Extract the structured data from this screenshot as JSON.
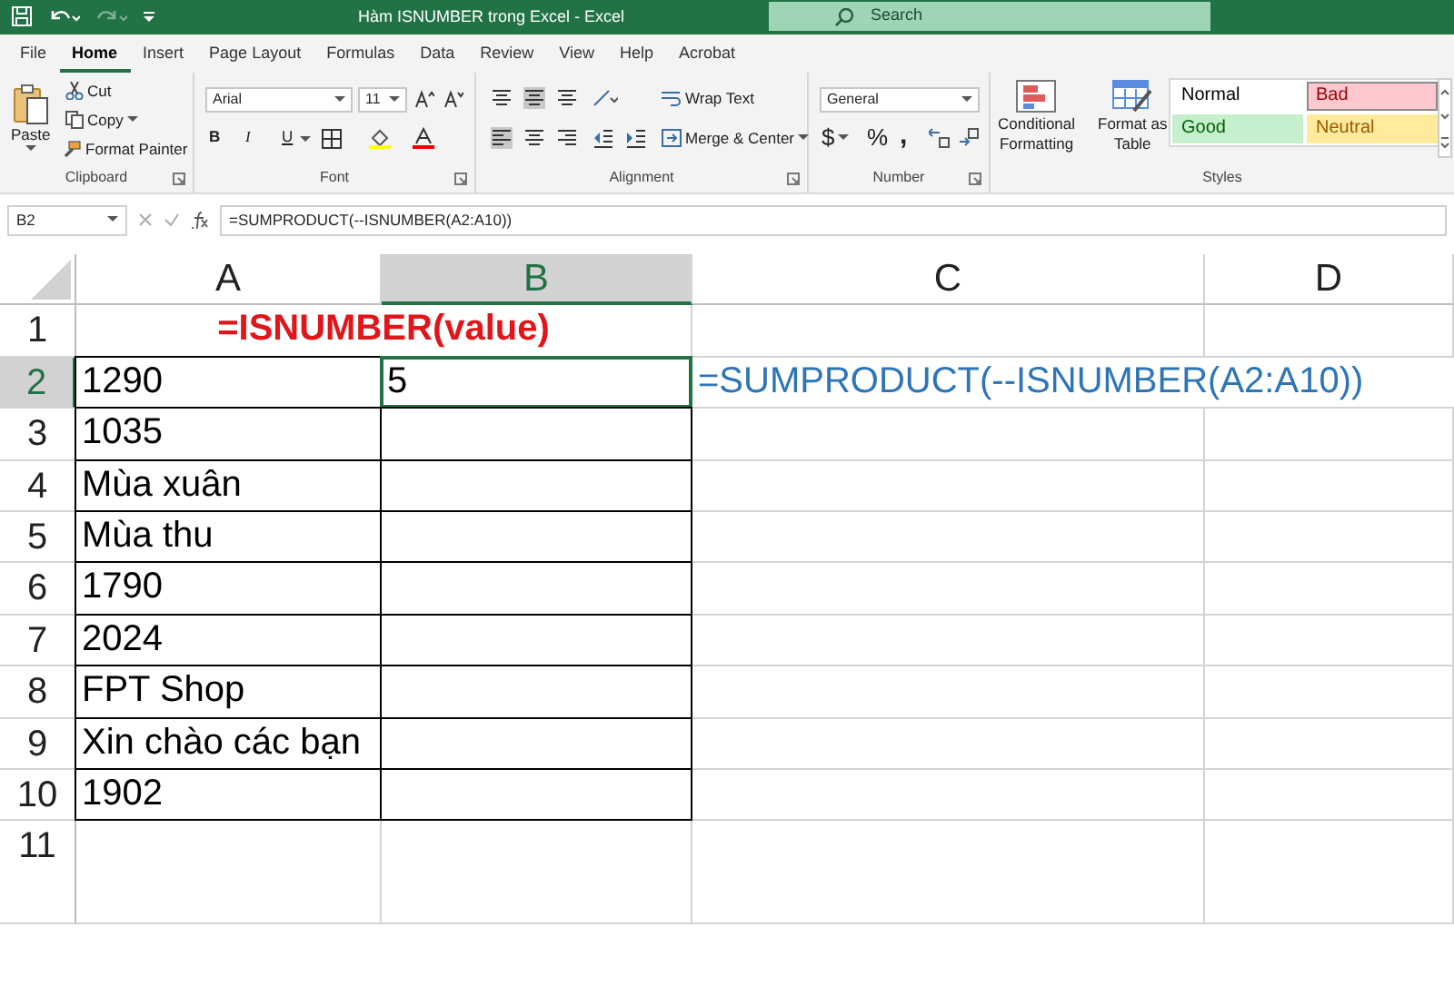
{
  "title_bar": {
    "title": "Hàm ISNUMBER trong Excel  -  Excel",
    "search_placeholder": "Search"
  },
  "menu_tabs": [
    {
      "label": "File",
      "selected": false
    },
    {
      "label": "Home",
      "selected": true
    },
    {
      "label": "Insert",
      "selected": false
    },
    {
      "label": "Page Layout",
      "selected": false
    },
    {
      "label": "Formulas",
      "selected": false
    },
    {
      "label": "Data",
      "selected": false
    },
    {
      "label": "Review",
      "selected": false
    },
    {
      "label": "View",
      "selected": false
    },
    {
      "label": "Help",
      "selected": false
    },
    {
      "label": "Acrobat",
      "selected": false
    }
  ],
  "ribbon": {
    "clipboard": {
      "paste": "Paste",
      "cut": "Cut",
      "copy": "Copy",
      "format_painter": "Format Painter",
      "label": "Clipboard"
    },
    "font": {
      "font_name": "Arial",
      "font_size": "11",
      "bold": "B",
      "italic": "I",
      "underline": "U",
      "label": "Font"
    },
    "alignment": {
      "wrap_text": "Wrap Text",
      "merge_center": "Merge & Center",
      "label": "Alignment"
    },
    "number": {
      "format": "General",
      "currency": "$",
      "percent": "%",
      "comma": ",",
      "label": "Number"
    },
    "styles": {
      "conditional_formatting": [
        "Conditional",
        "Formatting"
      ],
      "format_as_table": [
        "Format as",
        "Table"
      ],
      "gallery": [
        {
          "label": "Normal",
          "kind": "normal",
          "selected": false
        },
        {
          "label": "Bad",
          "kind": "bad",
          "selected": true
        },
        {
          "label": "Good",
          "kind": "good",
          "selected": false
        },
        {
          "label": "Neutral",
          "kind": "neutral",
          "selected": false
        }
      ],
      "label": "Styles"
    }
  },
  "formula_bar": {
    "name_box": "B2",
    "formula": "=SUMPRODUCT(--ISNUMBER(A2:A10))"
  },
  "sheet": {
    "columns": [
      {
        "label": "A",
        "selected": false
      },
      {
        "label": "B",
        "selected": true
      },
      {
        "label": "C",
        "selected": false
      },
      {
        "label": "D",
        "selected": false
      }
    ],
    "rows": [
      {
        "label": "1",
        "selected": false,
        "cells": {
          "ab": {
            "text": "=ISNUMBER(value)",
            "kind": "title",
            "selected": false
          }
        }
      },
      {
        "label": "2",
        "selected": true,
        "cells": {
          "a": {
            "text": "1290",
            "kind": "value",
            "selected": false
          },
          "b": {
            "text": "5",
            "kind": "value",
            "selected": true
          },
          "c": {
            "text": "=SUMPRODUCT(--ISNUMBER(A2:A10))",
            "kind": "formula",
            "selected": false
          }
        }
      },
      {
        "label": "3",
        "selected": false,
        "cells": {
          "a": {
            "text": "1035",
            "kind": "value",
            "selected": false
          },
          "b": {
            "kind": "value",
            "selected": false
          }
        }
      },
      {
        "label": "4",
        "selected": false,
        "cells": {
          "a": {
            "text": "Mùa xuân",
            "kind": "value",
            "selected": false
          },
          "b": {
            "kind": "value",
            "selected": false
          }
        }
      },
      {
        "label": "5",
        "selected": false,
        "cells": {
          "a": {
            "text": "Mùa thu",
            "kind": "value",
            "selected": false
          },
          "b": {
            "kind": "value",
            "selected": false
          }
        }
      },
      {
        "label": "6",
        "selected": false,
        "cells": {
          "a": {
            "text": "1790",
            "kind": "value",
            "selected": false
          },
          "b": {
            "kind": "value",
            "selected": false
          }
        }
      },
      {
        "label": "7",
        "selected": false,
        "cells": {
          "a": {
            "text": "2024",
            "kind": "value",
            "selected": false
          },
          "b": {
            "kind": "value",
            "selected": false
          }
        }
      },
      {
        "label": "8",
        "selected": false,
        "cells": {
          "a": {
            "text": "FPT Shop",
            "kind": "value",
            "selected": false
          },
          "b": {
            "kind": "value",
            "selected": false
          }
        }
      },
      {
        "label": "9",
        "selected": false,
        "cells": {
          "a": {
            "text": "Xin chào các bạn",
            "kind": "value",
            "selected": false
          },
          "b": {
            "kind": "value",
            "selected": false
          }
        }
      },
      {
        "label": "10",
        "selected": false,
        "cells": {
          "a": {
            "text": "1902",
            "kind": "value",
            "selected": false
          },
          "b": {
            "kind": "value",
            "selected": false
          }
        }
      },
      {
        "label": "11",
        "selected": false,
        "cells": {}
      }
    ]
  }
}
